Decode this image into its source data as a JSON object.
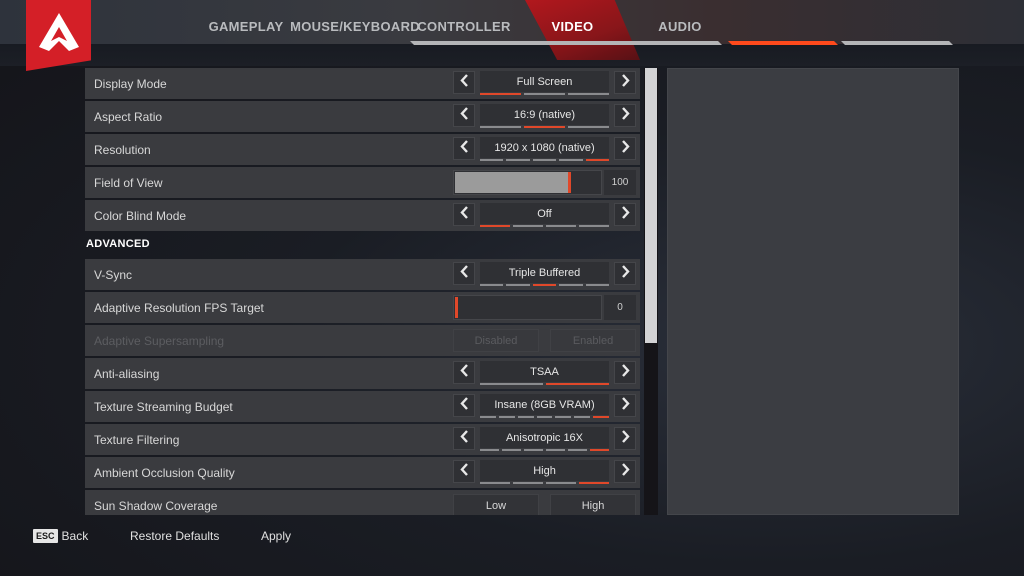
{
  "nav": {
    "logo": "apex-logo",
    "tabs": [
      {
        "label": "GAMEPLAY",
        "active": false
      },
      {
        "label": "MOUSE/KEYBOARD",
        "active": false
      },
      {
        "label": "CONTROLLER",
        "active": false
      },
      {
        "label": "VIDEO",
        "active": true
      },
      {
        "label": "AUDIO",
        "active": false
      }
    ]
  },
  "colors": {
    "accent": "#e0482a",
    "brand_red": "#d41f27",
    "row_bg": "#3a3b3f"
  },
  "settings": {
    "basic": [
      {
        "label": "Display Mode",
        "type": "selector",
        "value": "Full Screen",
        "options_count": 3,
        "selected_index": 0
      },
      {
        "label": "Aspect Ratio",
        "type": "selector",
        "value": "16:9 (native)",
        "options_count": 3,
        "selected_index": 1
      },
      {
        "label": "Resolution",
        "type": "selector",
        "value": "1920 x 1080 (native)",
        "options_count": 5,
        "selected_index": 4
      },
      {
        "label": "Field of View",
        "type": "slider",
        "value": "100",
        "fill_fraction": 0.77
      },
      {
        "label": "Color Blind Mode",
        "type": "selector",
        "value": "Off",
        "options_count": 4,
        "selected_index": 0
      }
    ],
    "advanced_header": "ADVANCED",
    "advanced": [
      {
        "label": "V-Sync",
        "type": "selector",
        "value": "Triple Buffered",
        "options_count": 5,
        "selected_index": 2
      },
      {
        "label": "Adaptive Resolution FPS Target",
        "type": "slider",
        "value": "0",
        "fill_fraction": 0.0
      },
      {
        "label": "Adaptive Supersampling",
        "type": "toggle",
        "disabled": true,
        "options": [
          "Disabled",
          "Enabled"
        ]
      },
      {
        "label": "Anti-aliasing",
        "type": "selector",
        "value": "TSAA",
        "options_count": 2,
        "selected_index": 1
      },
      {
        "label": "Texture Streaming Budget",
        "type": "selector",
        "value": "Insane (8GB VRAM)",
        "options_count": 7,
        "selected_index": 6
      },
      {
        "label": "Texture Filtering",
        "type": "selector",
        "value": "Anisotropic 16X",
        "options_count": 6,
        "selected_index": 5
      },
      {
        "label": "Ambient Occlusion Quality",
        "type": "selector",
        "value": "High",
        "options_count": 4,
        "selected_index": 3
      },
      {
        "label": "Sun Shadow Coverage",
        "type": "toggle",
        "disabled": false,
        "options": [
          "Low",
          "High"
        ]
      }
    ]
  },
  "scrollbar": {
    "position_fraction": 0.0,
    "visible_fraction": 0.62
  },
  "footer": {
    "esc_key": "ESC",
    "back_label": "Back",
    "restore_label": "Restore Defaults",
    "apply_label": "Apply"
  }
}
